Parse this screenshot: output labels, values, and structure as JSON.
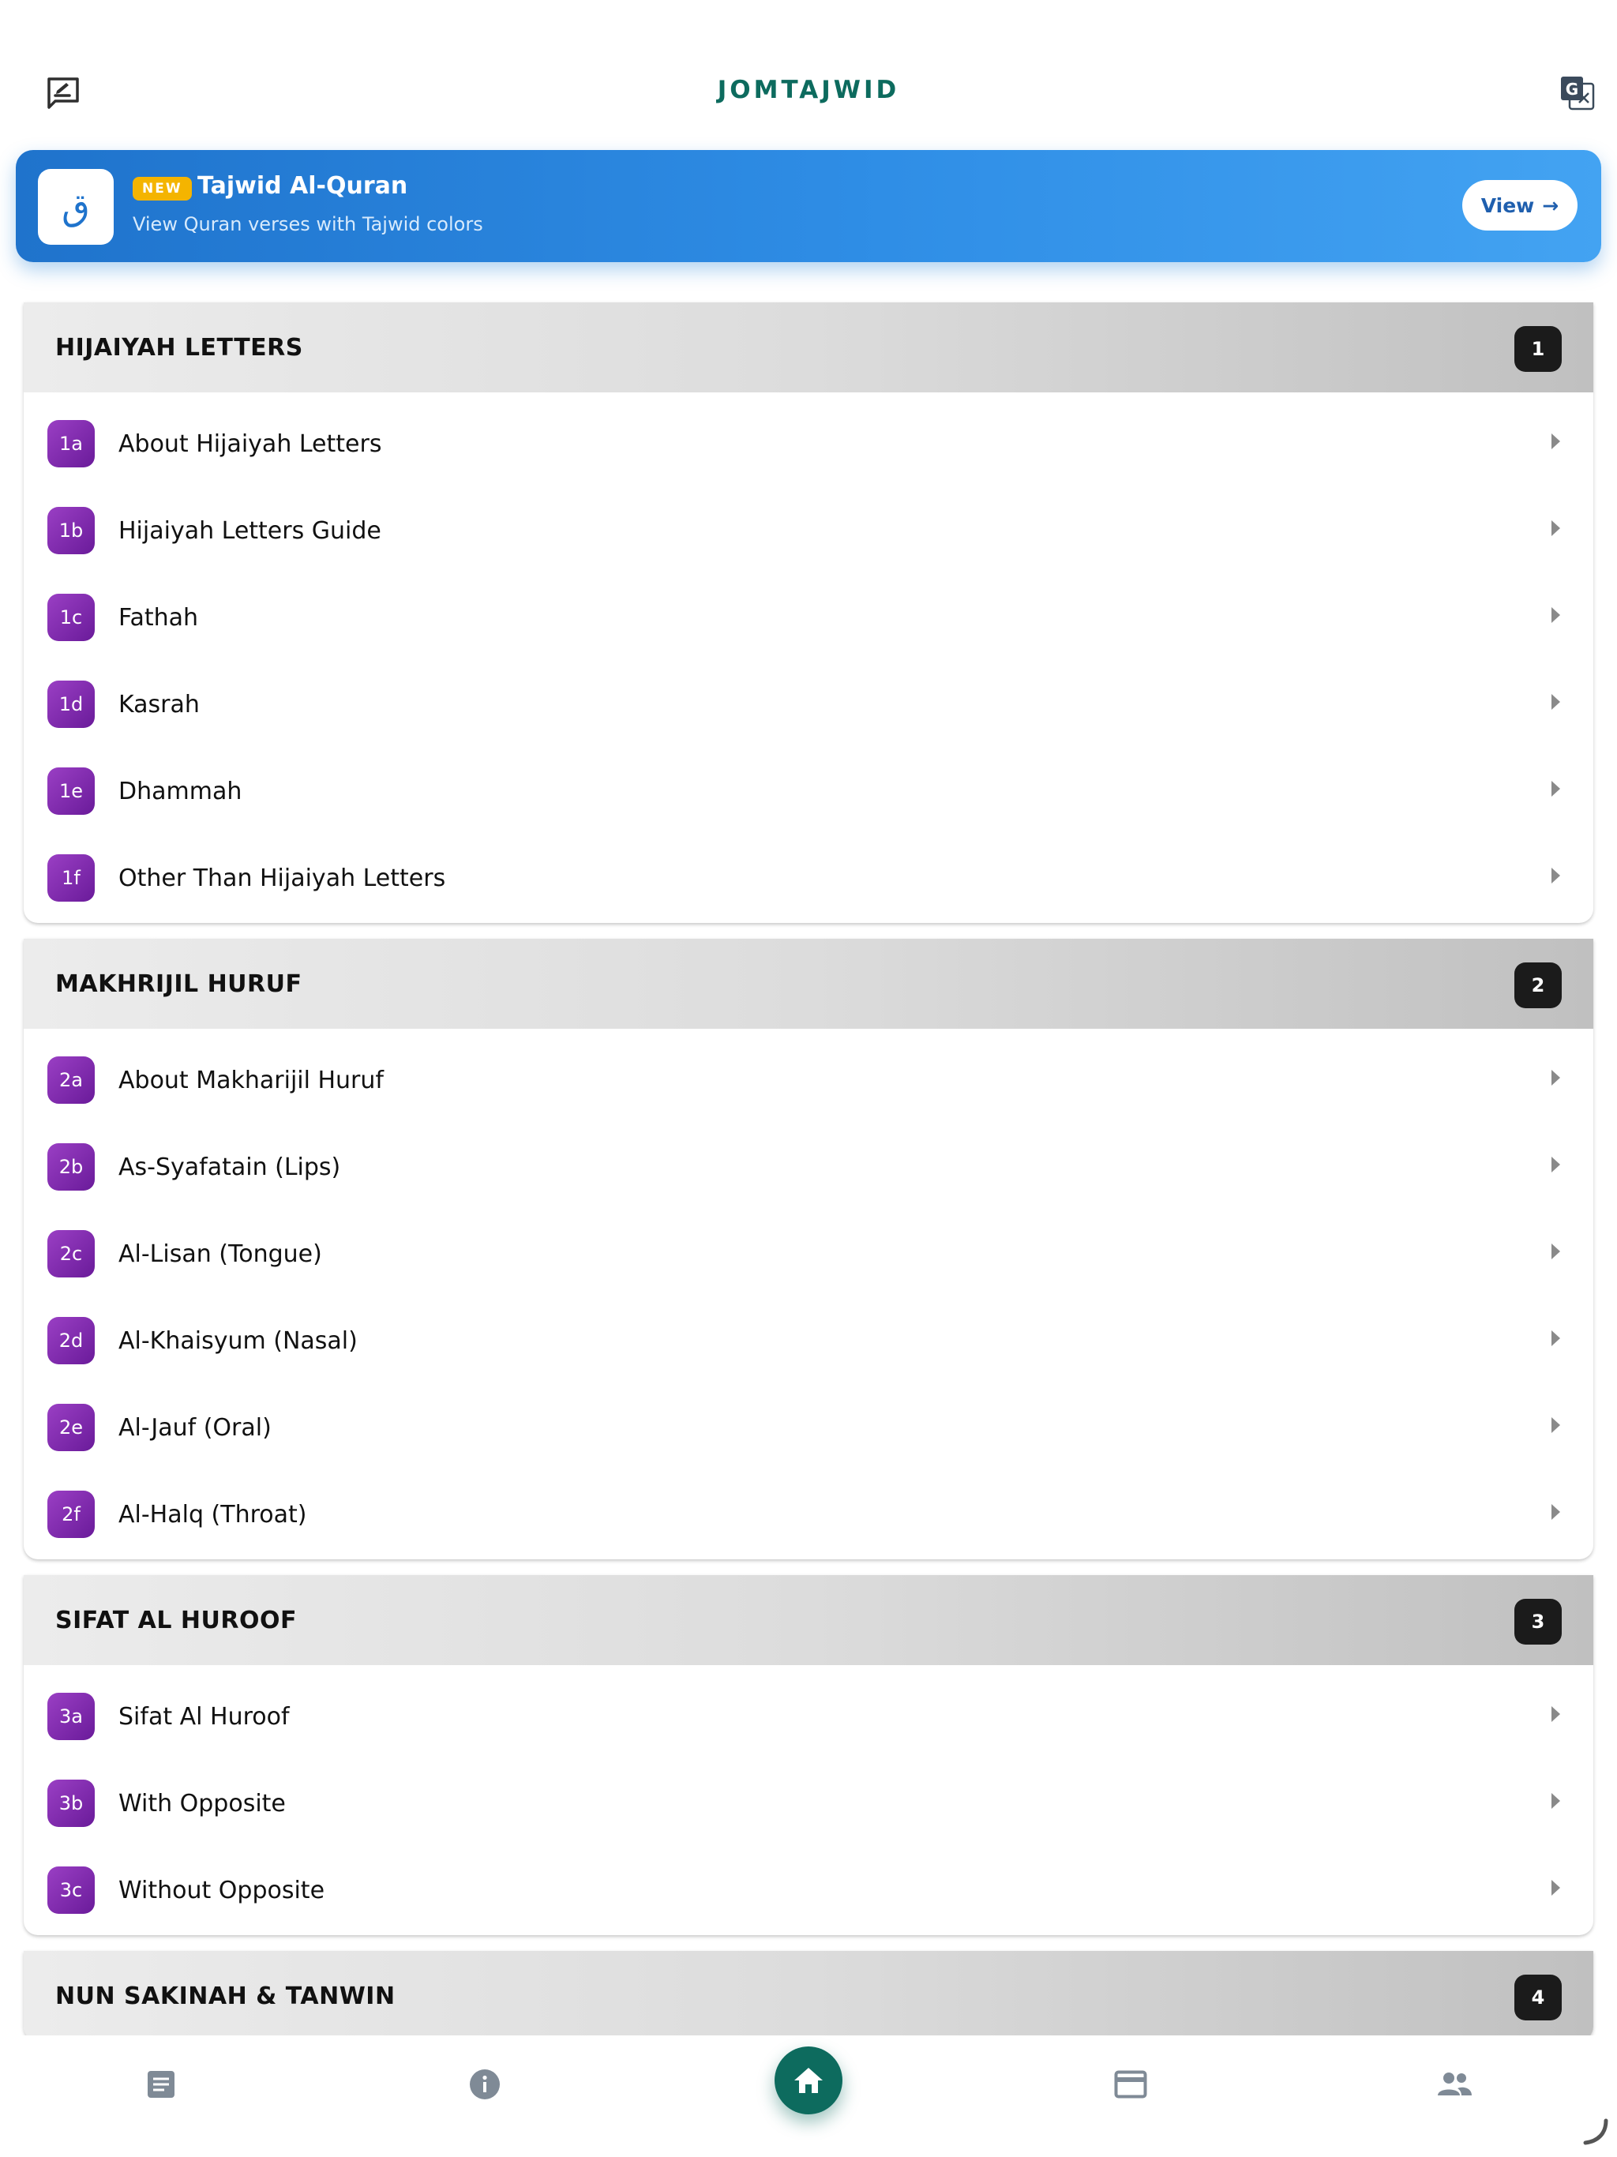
{
  "app": {
    "title": "JOMTAJWID"
  },
  "banner": {
    "logo_glyph": "ق",
    "badge": "NEW",
    "title": "Tajwid Al-Quran",
    "subtitle": "View Quran verses with Tajwid colors",
    "view_label": "View",
    "arrow": "→"
  },
  "sections": [
    {
      "title": "HIJAIYAH LETTERS",
      "number": "1",
      "items": [
        {
          "code": "1a",
          "label": "About Hijaiyah Letters"
        },
        {
          "code": "1b",
          "label": "Hijaiyah Letters Guide"
        },
        {
          "code": "1c",
          "label": "Fathah"
        },
        {
          "code": "1d",
          "label": "Kasrah"
        },
        {
          "code": "1e",
          "label": "Dhammah"
        },
        {
          "code": "1f",
          "label": "Other Than Hijaiyah Letters"
        }
      ]
    },
    {
      "title": "MAKHRIJIL HURUF",
      "number": "2",
      "items": [
        {
          "code": "2a",
          "label": "About Makharijil Huruf"
        },
        {
          "code": "2b",
          "label": "As-Syafatain (Lips)"
        },
        {
          "code": "2c",
          "label": "Al-Lisan (Tongue)"
        },
        {
          "code": "2d",
          "label": "Al-Khaisyum (Nasal)"
        },
        {
          "code": "2e",
          "label": "Al-Jauf (Oral)"
        },
        {
          "code": "2f",
          "label": "Al-Halq (Throat)"
        }
      ]
    },
    {
      "title": "SIFAT AL HUROOF",
      "number": "3",
      "items": [
        {
          "code": "3a",
          "label": "Sifat Al Huroof"
        },
        {
          "code": "3b",
          "label": "With Opposite"
        },
        {
          "code": "3c",
          "label": "Without Opposite"
        }
      ]
    },
    {
      "title": "NUN SAKINAH & TANWIN",
      "number": "4",
      "items": []
    }
  ],
  "colors": {
    "brand": "#0d6b5e",
    "banner_start": "#1f73cc",
    "banner_end": "#43a3f2",
    "badge": "#f4b400",
    "item_badge": "#7b2aa8",
    "nav_icon": "#7f8a96"
  },
  "icons": {
    "header_left": "edit-note-icon",
    "header_right": "translate-icon",
    "nav": [
      "article-icon",
      "info-icon",
      "home-icon",
      "card-icon",
      "people-icon"
    ]
  }
}
